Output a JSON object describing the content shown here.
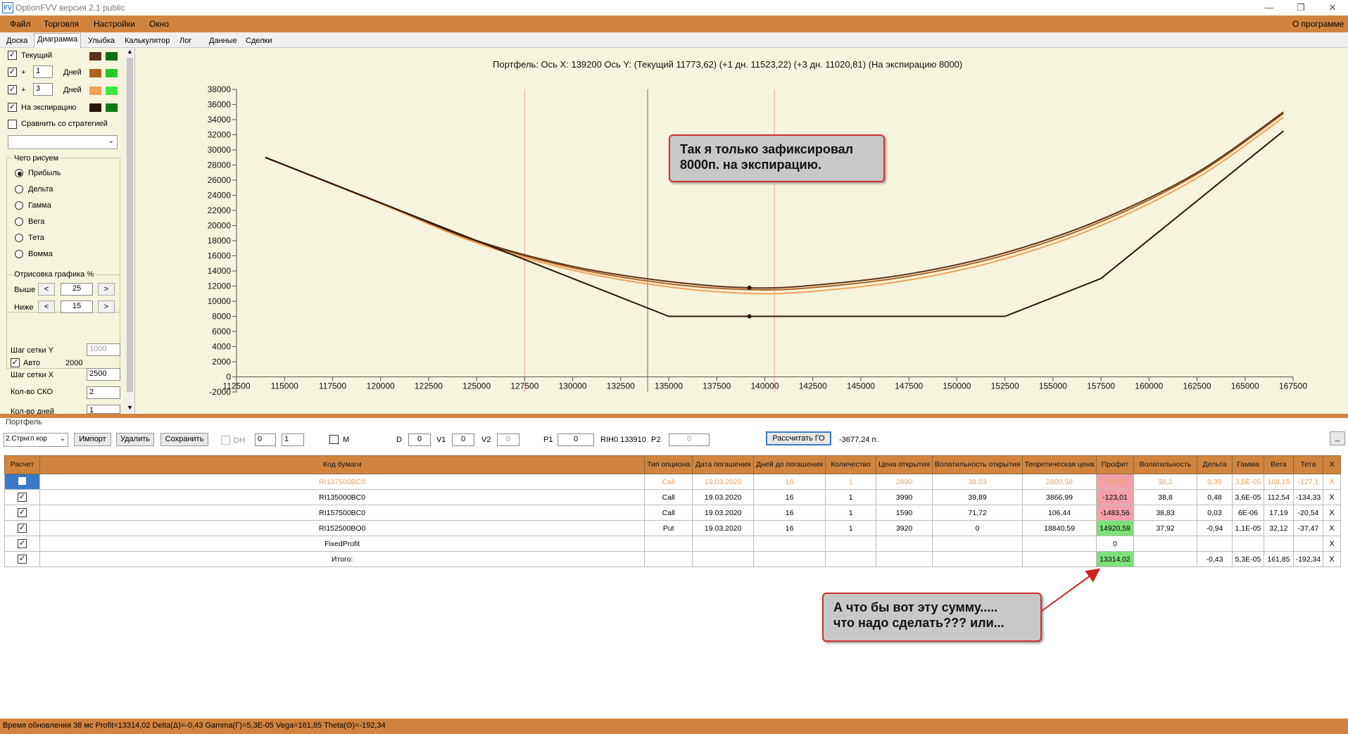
{
  "window": {
    "title": "OptionFVV версия 2.1 public",
    "icon_text": "FV"
  },
  "menu": {
    "items": [
      "Файл",
      "Торговля",
      "Настройки",
      "Окно"
    ],
    "about": "О программе"
  },
  "tabs": [
    "Доска",
    "Диаграмма",
    "Улыбка",
    "Калькулятор",
    "Лог",
    "Данные",
    "Сделки"
  ],
  "active_tab": "Диаграмма",
  "left": {
    "rows": [
      {
        "checked": true,
        "label": "Текущий",
        "color1": "#5a3218",
        "color2": "#0e6e14"
      },
      {
        "checked": true,
        "prefix": "+",
        "value": "1",
        "unit": "Дней",
        "color1": "#b06020",
        "color2": "#28c828"
      },
      {
        "checked": true,
        "prefix": "+",
        "value": "3",
        "unit": "Дней",
        "color1": "#f4a058",
        "color2": "#3ee83e"
      },
      {
        "checked": true,
        "label": "На экспирацию",
        "color1": "#2a1608",
        "color2": "#0e7a14"
      }
    ],
    "compare_label": "Сравнить со стратегией",
    "draw_group": "Чего рисуем",
    "draw_options": [
      "Прибыль",
      "Дельта",
      "Гамма",
      "Вега",
      "Тета",
      "Вомма"
    ],
    "draw_selected": "Прибыль",
    "render_group": "Отрисовка графика %",
    "above_label": "Выше",
    "above_value": "25",
    "below_label": "Ниже",
    "below_value": "15",
    "grid_y_label": "Шаг сетки Y",
    "grid_y_value": "1000",
    "auto_label": "Авто",
    "auto_value": "2000",
    "grid_x_label": "Шаг сетки X",
    "grid_x_value": "2500",
    "sko_label": "Кол-во СКО",
    "sko_value": "2",
    "days_label": "Кол-во дней",
    "days_value": "1"
  },
  "chart_title": "Портфель: Ось X: 139200 Ось Y:  (Текущий 11773,62)  (+1 дн. 11523,22)  (+3 дн. 11020,81)  (На экспирацию 8000)",
  "chart_data": {
    "type": "line",
    "title": "Портфель: Ось X: 139200 Ось Y:  (Текущий 11773,62)  (+1 дн. 11523,22)  (+3 дн. 11020,81)  (На экспирацию 8000)",
    "xlim": [
      112500,
      167500
    ],
    "ylim": [
      -2000,
      38000
    ],
    "x_ticks": [
      112500,
      115000,
      117500,
      120000,
      122500,
      125000,
      127500,
      130000,
      132500,
      135000,
      137500,
      140000,
      142500,
      145000,
      147500,
      150000,
      152500,
      155000,
      157500,
      160000,
      162500,
      165000,
      167500
    ],
    "y_ticks": [
      -2000,
      0,
      2000,
      4000,
      6000,
      8000,
      10000,
      12000,
      14000,
      16000,
      18000,
      20000,
      22000,
      24000,
      26000,
      28000,
      30000,
      32000,
      34000,
      36000,
      38000
    ],
    "vlines": [
      {
        "x": 127500,
        "color": "#f0a0a8"
      },
      {
        "x": 133900,
        "color": "#607080"
      },
      {
        "x": 140500,
        "color": "#f0a0a8"
      }
    ],
    "series": [
      {
        "color": "#2a1608",
        "x": [
          114000,
          135000,
          152500,
          157500,
          167000
        ],
        "values": [
          29000,
          8000,
          8000,
          13000,
          32500
        ]
      },
      {
        "color": "#5a3218",
        "x": [
          114000,
          120000,
          125000,
          130000,
          135000,
          139200,
          142500,
          147500,
          152500,
          157500,
          162500,
          167000
        ],
        "values": [
          29000,
          23000,
          18000,
          14600,
          12600,
          11773,
          12100,
          13600,
          16400,
          20800,
          27000,
          35000
        ]
      },
      {
        "color": "#b06020",
        "x": [
          114000,
          120000,
          125000,
          130000,
          135000,
          139200,
          142500,
          147500,
          152500,
          157500,
          162500,
          167000
        ],
        "values": [
          29000,
          23000,
          17900,
          14400,
          12300,
          11523,
          11800,
          13300,
          16100,
          20500,
          26800,
          34800
        ]
      },
      {
        "color": "#f4a058",
        "x": [
          114000,
          120000,
          125000,
          130000,
          135000,
          139200,
          142500,
          147500,
          152500,
          157500,
          162500,
          167000
        ],
        "values": [
          29000,
          22900,
          17700,
          14100,
          11900,
          11021,
          11300,
          12800,
          15600,
          20000,
          26300,
          34300
        ]
      }
    ],
    "markers": [
      {
        "x": 139200,
        "y": 11774
      },
      {
        "x": 139200,
        "y": 8000
      }
    ]
  },
  "callouts": {
    "top": [
      "Так я только зафиксировал",
      "8000п. на экспирацию."
    ],
    "bottom": [
      "А что бы вот эту сумму.....",
      "что надо сделать??? или..."
    ]
  },
  "portfolio": {
    "label": "Портфель",
    "select": "2.Стрнгл кор",
    "import": "Импорт",
    "delete": "Удалить",
    "save": "Сохранить",
    "dh": "DH",
    "spin1": "0",
    "spin2": "1",
    "m": "M",
    "d_label": "D",
    "d_value": "0",
    "v1_label": "V1",
    "v1_value": "0",
    "v2_label": "V2",
    "v2_value": "0",
    "p1_label": "P1",
    "p1_value": "0",
    "rih": "RIH0 133910",
    "p2_label": "P2",
    "p2_value": "0",
    "calc_go": "Рассчитать ГО",
    "go_value": "-3677,24 п.",
    "minimize": "_"
  },
  "table": {
    "headers": [
      "Расчет",
      "Код бумаги",
      "Тип опциона",
      "Дата погашения",
      "Дней до погашения",
      "Количество",
      "Цена открытия",
      "Волатильность открытия",
      "Теоретическая цена",
      "Профит",
      "Волатильность",
      "Дельта",
      "Гамма",
      "Вега",
      "Тета",
      "X"
    ],
    "rows": [
      {
        "checked": false,
        "dim": true,
        "cells": [
          "RI137500BC0",
          "Call",
          "19.03.2020",
          "16",
          "1",
          "2890",
          "39,03",
          "2800,58",
          "-89,42",
          "38,2",
          "0,39",
          "3,5E-05",
          "108,15",
          "-127,1",
          "X"
        ],
        "profit_class": "pink"
      },
      {
        "checked": true,
        "cells": [
          "RI135000BC0",
          "Call",
          "19.03.2020",
          "16",
          "1",
          "3990",
          "39,89",
          "3866,99",
          "-123,01",
          "38,8",
          "0,48",
          "3,6E-05",
          "112,54",
          "-134,33",
          "X"
        ],
        "profit_class": "pink"
      },
      {
        "checked": true,
        "cells": [
          "RI157500BC0",
          "Call",
          "19.03.2020",
          "16",
          "1",
          "1590",
          "71,72",
          "106,44",
          "-1483,56",
          "38,83",
          "0,03",
          "6E-06",
          "17,19",
          "-20,54",
          "X"
        ],
        "profit_class": "pink"
      },
      {
        "checked": true,
        "cells": [
          "RI152500BO0",
          "Put",
          "19.03.2020",
          "16",
          "1",
          "3920",
          "0",
          "18840,59",
          "14920,59",
          "37,92",
          "-0,94",
          "1,1E-05",
          "32,12",
          "-37,47",
          "X"
        ],
        "profit_class": "green"
      },
      {
        "checked": true,
        "cells": [
          "FixedProfit",
          "",
          "",
          "",
          "",
          "",
          "",
          "",
          "0",
          "",
          "",
          "",
          "",
          "",
          "X"
        ],
        "profit_class": ""
      },
      {
        "checked": true,
        "cells": [
          "Итого:",
          "",
          "",
          "",
          "",
          "",
          "",
          "",
          "13314,02",
          "",
          "-0,43",
          "5,3E-05",
          "161,85",
          "-192,34",
          "X"
        ],
        "profit_class": "green"
      }
    ]
  },
  "status": "Время обновления 38 мс  Profit=13314,02 Delta(Δ)=-0,43 Gamma(Γ)=5,3E-05 Vega=161,85 Theta(Θ)=-192,34"
}
